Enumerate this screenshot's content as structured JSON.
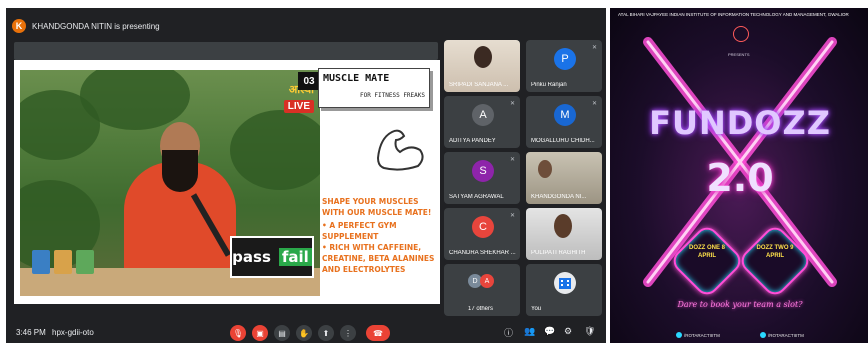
{
  "meeting": {
    "presenter_initial": "K",
    "presenter_text": "KHANDGONDA NITIN is presenting",
    "time": "3:46 PM",
    "meeting_code": "hpx-gdii-oto"
  },
  "slide": {
    "number": "03",
    "title": "MUSCLE MATE",
    "subtitle": "FOR FITNESS FREAKS",
    "headline": "SHAPE YOUR MUSCLES WITH OUR MUSCLE MATE!",
    "bullets": [
      "A PERFECT GYM SUPPLEMENT",
      "RICH WITH CAFFEINE, CREATINE, BETA ALANINES AND ELECTROLYTES"
    ],
    "video_overlay": {
      "channel_logo": "आस्था",
      "live_label": "LIVE",
      "pass_text": "pass",
      "fail_text": "fail"
    }
  },
  "participants": [
    {
      "name": "SRIPADI SANJANA ...",
      "type": "photo",
      "photo_color": "#d8cfc2"
    },
    {
      "name": "Pinku Ranjan",
      "initial": "P",
      "avatar_color": "#1a73e8"
    },
    {
      "name": "ADITYA PANDEY",
      "initial": "A",
      "avatar_color": "#5f6368"
    },
    {
      "name": "MOGALLURU CHIDH...",
      "initial": "M",
      "avatar_color": "#1967d2"
    },
    {
      "name": "SATYAM AGRAWAL",
      "initial": "S",
      "avatar_color": "#8e24aa"
    },
    {
      "name": "KHANDGONDA NI...",
      "type": "photo",
      "photo_color": "#b7b09e"
    },
    {
      "name": "CHANDRA SHEKHAR ...",
      "initial": "C",
      "avatar_color": "#e8453c"
    },
    {
      "name": "PULIPATI RAGHITH",
      "type": "photo",
      "photo_color": "#cfcfcf"
    },
    {
      "name": "17 others",
      "initials": [
        "D",
        "A"
      ]
    },
    {
      "name": "You",
      "type": "self"
    }
  ],
  "poster": {
    "header": "ATAL BIHARI VAJPAYEE INDIAN INSTITUTE OF INFORMATION TECHNOLOGY AND MANAGEMENT, GWALIOR",
    "presents": "PRESENTS",
    "title": "FUNDOZZ",
    "version": "2.0",
    "badge1": "DOZZ ONE 8 APRIL",
    "badge2": "DOZZ TWO 9 APRIL",
    "tagline": "Dare to book your team a slot?",
    "social1": "/ROTARACTIIITM",
    "social2": "/ROTARACTIIITM"
  }
}
